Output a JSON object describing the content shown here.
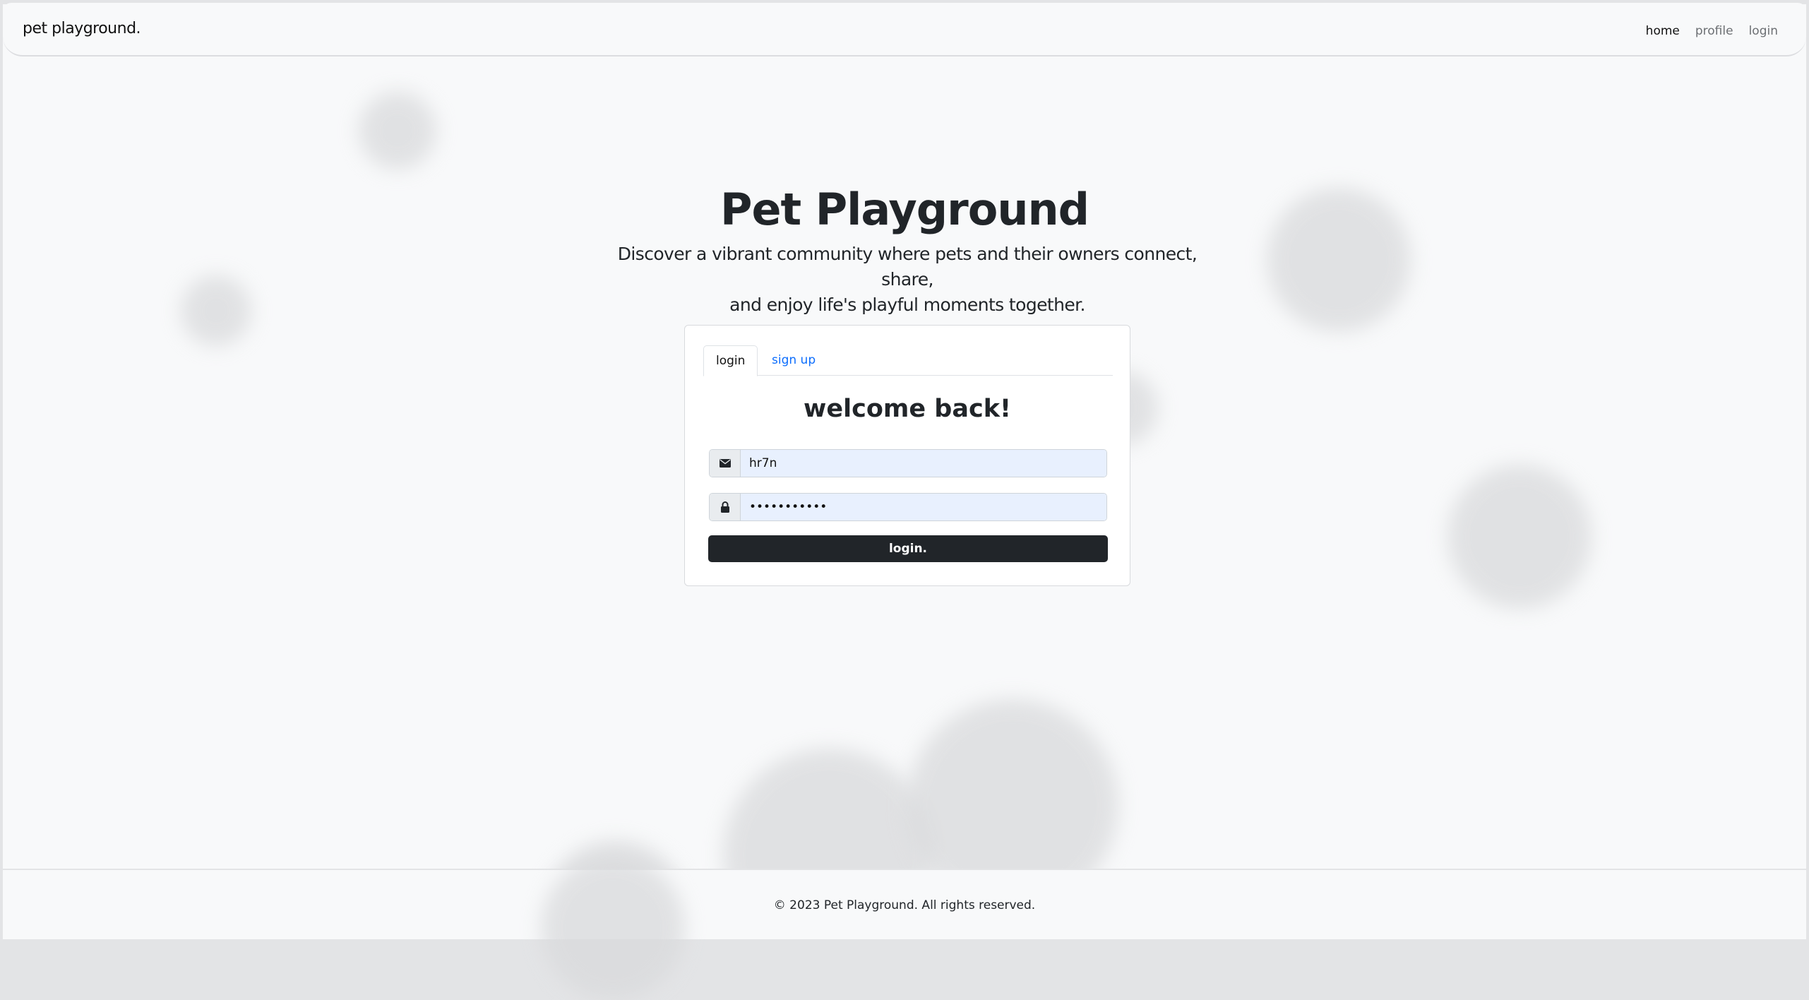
{
  "navbar": {
    "brand": "pet playground.",
    "links": [
      {
        "label": "home",
        "active": true
      },
      {
        "label": "profile",
        "active": false
      },
      {
        "label": "login",
        "active": false
      }
    ]
  },
  "hero": {
    "title": "Pet Playground",
    "subtitle_line1": "Discover a vibrant community where pets and their owners connect, share,",
    "subtitle_line2": "and enjoy life's playful moments together."
  },
  "auth_card": {
    "tabs": [
      {
        "label": "login",
        "active": true
      },
      {
        "label": "sign up",
        "active": false
      }
    ],
    "heading": "welcome back!",
    "email": {
      "icon": "envelope-icon",
      "value": "hr7n"
    },
    "password": {
      "icon": "lock-icon",
      "value": "hr7nhr7nhr7"
    },
    "submit_label": "login."
  },
  "footer": {
    "copyright": "© 2023 Pet Playground. All rights reserved."
  },
  "colors": {
    "background": "#f8f9fa",
    "primary_button": "#212529",
    "link": "#0d6efd",
    "autofill": "#e8f0fe"
  }
}
